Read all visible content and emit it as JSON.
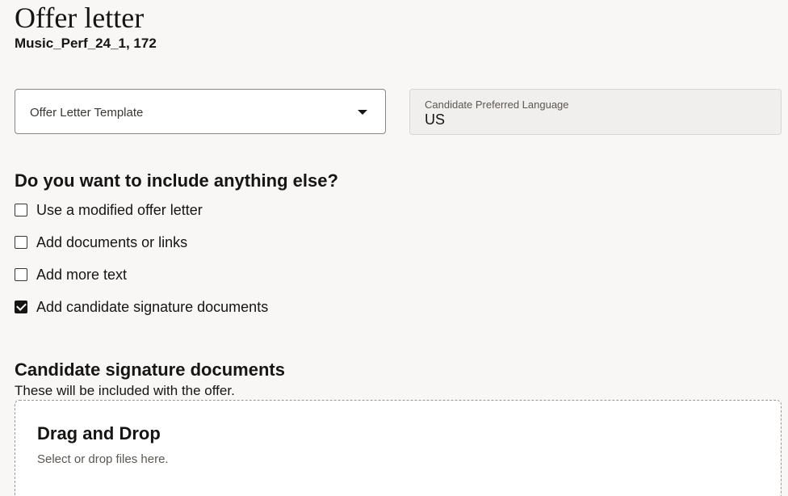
{
  "header": {
    "title": "Offer letter",
    "subtitle": "Music_Perf_24_1, 172"
  },
  "template_select": {
    "label": "Offer Letter Template",
    "icon": "chevron-down-icon"
  },
  "language": {
    "label": "Candidate Preferred Language",
    "value": "US"
  },
  "include_section": {
    "heading": "Do you want to include anything else?",
    "options": [
      {
        "label": "Use a modified offer letter",
        "checked": false
      },
      {
        "label": "Add documents or links",
        "checked": false
      },
      {
        "label": "Add more text",
        "checked": false
      },
      {
        "label": "Add candidate signature documents",
        "checked": true
      }
    ]
  },
  "signature_docs": {
    "heading": "Candidate signature documents",
    "description": "These will be included with the offer.",
    "dropzone": {
      "title": "Drag and Drop",
      "hint": "Select or drop files here."
    }
  }
}
